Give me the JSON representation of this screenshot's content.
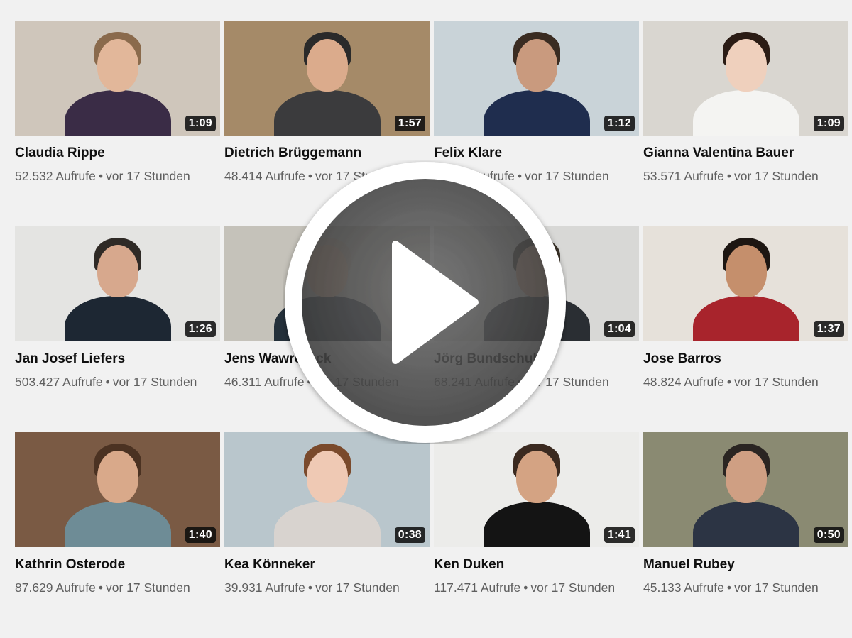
{
  "videos": [
    {
      "name": "Claudia Rippe",
      "views": "52.532 Aufrufe",
      "age": "vor 17 Stunden",
      "duration": "1:09",
      "bg": "#cfc6bb",
      "skin": "#e2b79a",
      "hair": "#8a6a4c",
      "shirt": "#3a2c46"
    },
    {
      "name": "Dietrich Brüggemann",
      "views": "48.414 Aufrufe",
      "age": "vor 17 Stunden",
      "duration": "1:57",
      "bg": "#a58a68",
      "skin": "#dbab8c",
      "hair": "#2a2a2a",
      "shirt": "#3b3b3d"
    },
    {
      "name": "Felix Klare",
      "views": "43.868 Aufrufe",
      "age": "vor 17 Stunden",
      "duration": "1:12",
      "bg": "#c9d3d8",
      "skin": "#c99a7e",
      "hair": "#3a2c22",
      "shirt": "#1f2d4e"
    },
    {
      "name": "Gianna Valentina Bauer",
      "views": "53.571 Aufrufe",
      "age": "vor 17 Stunden",
      "duration": "1:09",
      "bg": "#d9d6d0",
      "skin": "#efd0bd",
      "hair": "#2b1c15",
      "shirt": "#f4f4f2"
    },
    {
      "name": "Jan Josef Liefers",
      "views": "503.427 Aufrufe",
      "age": "vor 17 Stunden",
      "duration": "1:26",
      "bg": "#e4e4e2",
      "skin": "#d7a88d",
      "hair": "#2f2a26",
      "shirt": "#1d2733"
    },
    {
      "name": "Jens Wawrczeck",
      "views": "46.311 Aufrufe",
      "age": "vor 17 Stunden",
      "duration": "",
      "bg": "#c5c2ba",
      "skin": "#e0b597",
      "hair": "#c9b8a6",
      "shirt": "#24303a"
    },
    {
      "name": "Jörg Bundschuh",
      "views": "68.241 Aufrufe",
      "age": "vor 17 Stunden",
      "duration": "1:04",
      "bg": "#d8d8d6",
      "skin": "#d6a689",
      "hair": "#3a3228",
      "shirt": "#2a2e33"
    },
    {
      "name": "Jose Barros",
      "views": "48.824 Aufrufe",
      "age": "vor 17 Stunden",
      "duration": "1:37",
      "bg": "#e6e1da",
      "skin": "#c58f6c",
      "hair": "#1d1612",
      "shirt": "#a8242c"
    },
    {
      "name": "Kathrin Osterode",
      "views": "87.629 Aufrufe",
      "age": "vor 17 Stunden",
      "duration": "1:40",
      "bg": "#7a5a44",
      "skin": "#d9a98a",
      "hair": "#4b3222",
      "shirt": "#6e8c96"
    },
    {
      "name": "Kea Könneker",
      "views": "39.931 Aufrufe",
      "age": "vor 17 Stunden",
      "duration": "0:38",
      "bg": "#b9c6cc",
      "skin": "#efc9b4",
      "hair": "#7a4a2c",
      "shirt": "#d8d3cf"
    },
    {
      "name": "Ken Duken",
      "views": "117.471 Aufrufe",
      "age": "vor 17 Stunden",
      "duration": "1:41",
      "bg": "#ececea",
      "skin": "#d4a383",
      "hair": "#3b2a20",
      "shirt": "#141414"
    },
    {
      "name": "Manuel Rubey",
      "views": "45.133 Aufrufe",
      "age": "vor 17 Stunden",
      "duration": "0:50",
      "bg": "#8a8a72",
      "skin": "#cf9f83",
      "hair": "#2a2522",
      "shirt": "#2c3444"
    }
  ],
  "meta_separator": "•",
  "overlay": {
    "icon": "play-icon"
  }
}
